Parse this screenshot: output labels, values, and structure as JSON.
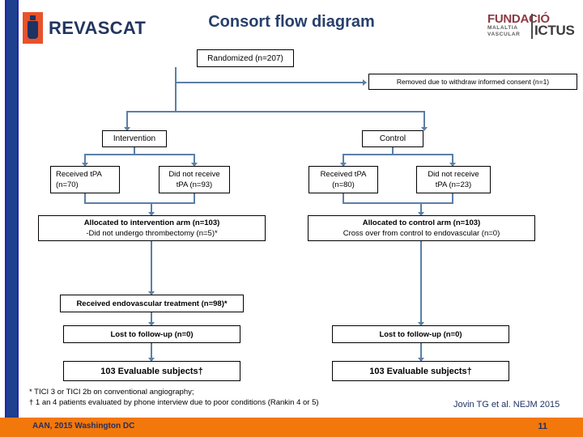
{
  "header": {
    "logo_left": {
      "name": "revascat-logo",
      "word": "REVASCAT"
    },
    "logo_right": {
      "name": "fundacio-ictus-logo",
      "line1": "FUNDACIÓ",
      "sub1": "MALALTIA",
      "sub2": "VASCULAR",
      "line2": "ICTUS"
    },
    "title": "Consort flow diagram"
  },
  "flow": {
    "randomized": "Randomized (n=207)",
    "removed": "Removed due to withdraw informed consent (n=1)",
    "intervention": "Intervention",
    "control": "Control",
    "int_received_tpa_l1": "Received tPA",
    "int_received_tpa_l2": "(n=70)",
    "int_not_received_l1": "Did not receive",
    "int_not_received_l2": "tPA (n=93)",
    "ctl_received_tpa_l1": "Received tPA",
    "ctl_received_tpa_l2": "(n=80)",
    "ctl_not_received_l1": "Did not receive",
    "ctl_not_received_l2": "tPA (n=23)",
    "alloc_int_l1": "Allocated to intervention arm (n=103)",
    "alloc_int_l2": "-Did not undergo thrombectomy (n=5)*",
    "alloc_ctl_l1": "Allocated to control arm (n=103)",
    "alloc_ctl_l2": "Cross over from control to endovascular (n=0)",
    "received_endo": "Received endovascular treatment (n=98)*",
    "lost_int": "Lost to follow-up (n=0)",
    "lost_ctl": "Lost to follow-up (n=0)",
    "evaluable_int": "103 Evaluable subjects†",
    "evaluable_ctl": "103 Evaluable subjects†"
  },
  "footnotes": {
    "line1": "* TICI 3 or TICI 2b on conventional angiography;",
    "line2": "† 1 an 4 patients evaluated by phone interview due to poor conditions (Rankin 4 or 5)"
  },
  "citation": "Jovin TG et al. NEJM 2015",
  "footer": {
    "left": "AAN, 2015 Washington DC",
    "page": "11"
  },
  "colors": {
    "sidebar_blue": "#1f3f8f",
    "title_navy": "#27406b",
    "connector_blue": "#5b7fa6",
    "footer_orange": "#f3780c",
    "logo_orange": "#e8522a",
    "logo_navy": "#1f3264",
    "fundacio_maroon": "#8e3a44"
  }
}
